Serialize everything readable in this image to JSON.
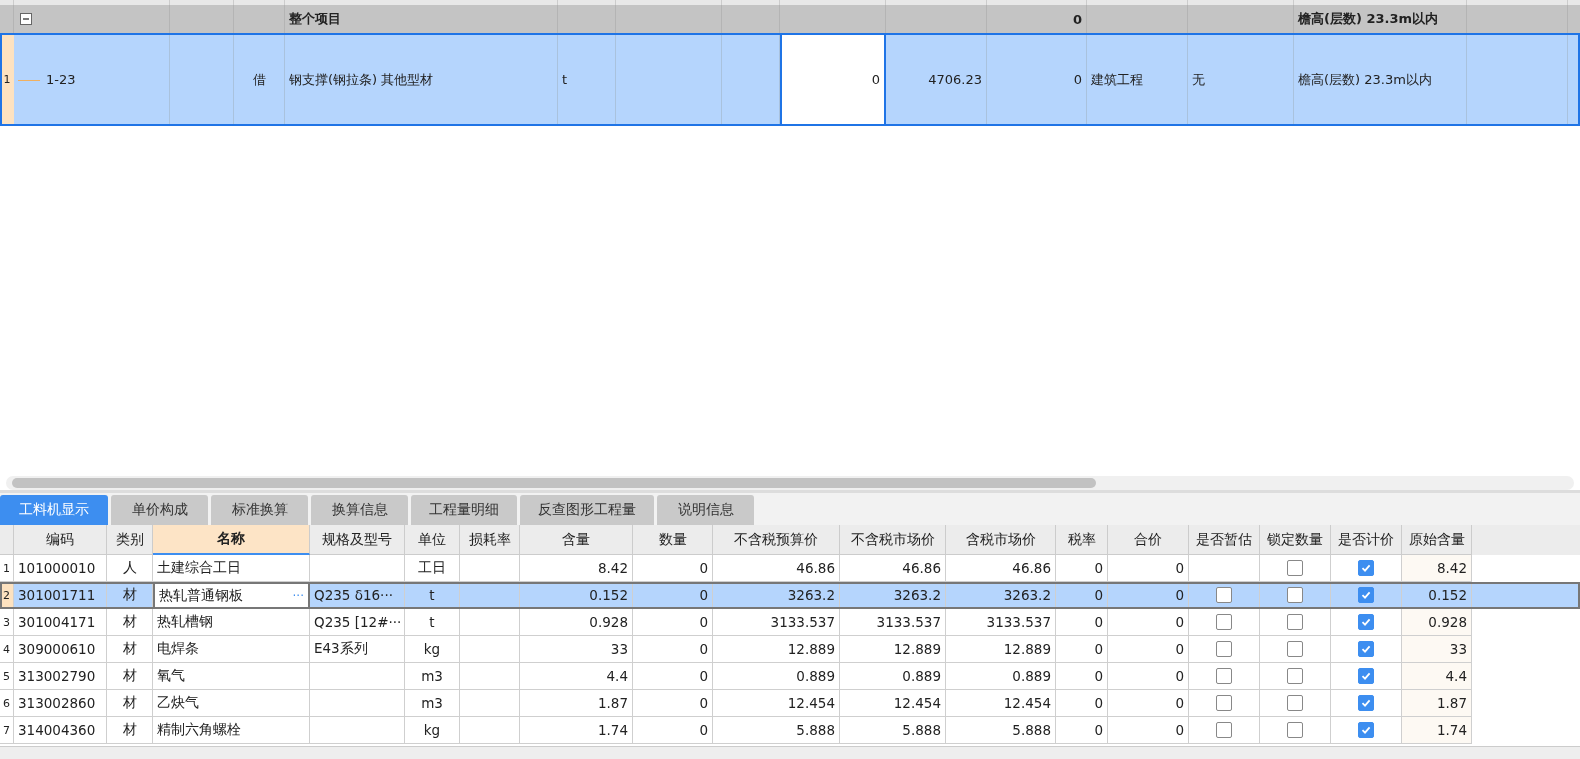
{
  "top_grid": {
    "group_row": {
      "expanded": true,
      "name": "整个项目",
      "total": "0",
      "height_class": "檐高(层数) 23.3m以内"
    },
    "rows": [
      {
        "row_number": "1",
        "selected": true,
        "code": "1-23",
        "mark": "借",
        "name": "钢支撑(钢拉条) 其他型材",
        "unit": "t",
        "quantity": "0",
        "quantity_editing": true,
        "price": "4706.23",
        "total": "0",
        "category": "建筑工程",
        "column_11": "无",
        "height_class": "檐高(层数) 23.3m以内"
      }
    ]
  },
  "tabs": [
    {
      "label": "工料机显示",
      "selected": true
    },
    {
      "label": "单价构成",
      "selected": false
    },
    {
      "label": "标准换算",
      "selected": false
    },
    {
      "label": "换算信息",
      "selected": false
    },
    {
      "label": "工程量明细",
      "selected": false
    },
    {
      "label": "反查图形工程量",
      "selected": false
    },
    {
      "label": "说明信息",
      "selected": false
    }
  ],
  "table": {
    "columns": [
      {
        "label": "编码",
        "selected": false
      },
      {
        "label": "类别",
        "selected": false
      },
      {
        "label": "名称",
        "selected": true
      },
      {
        "label": "规格及型号",
        "selected": false
      },
      {
        "label": "单位",
        "selected": false
      },
      {
        "label": "损耗率",
        "selected": false
      },
      {
        "label": "含量",
        "selected": false
      },
      {
        "label": "数量",
        "selected": false
      },
      {
        "label": "不含税预算价",
        "selected": false
      },
      {
        "label": "不含税市场价",
        "selected": false
      },
      {
        "label": "含税市场价",
        "selected": false
      },
      {
        "label": "税率",
        "selected": false
      },
      {
        "label": "合价",
        "selected": false
      },
      {
        "label": "是否暂估",
        "selected": false
      },
      {
        "label": "锁定数量",
        "selected": false
      },
      {
        "label": "是否计价",
        "selected": false
      },
      {
        "label": "原始含量",
        "selected": false
      }
    ],
    "rows": [
      {
        "row_number": "1",
        "selected": false,
        "code": "101000010",
        "type": "人",
        "name": "土建综合工日",
        "unit": "工日",
        "content": "8.42",
        "quantity": "0",
        "budget_price": "46.86",
        "market_price": "46.86",
        "tax_market_price": "46.86",
        "tax_rate": "0",
        "total": "0",
        "locked": false,
        "priced": true,
        "original_content": "8.42"
      },
      {
        "row_number": "2",
        "selected": true,
        "code": "301001711",
        "type": "材",
        "name": "热轧普通钢板",
        "name_button": "···",
        "spec": "Q235 δ16···",
        "unit": "t",
        "content": "0.152",
        "quantity": "0",
        "budget_price": "3263.2",
        "market_price": "3263.2",
        "tax_market_price": "3263.2",
        "tax_rate": "0",
        "total": "0",
        "provisional": false,
        "locked": false,
        "priced": true,
        "original_content": "0.152"
      },
      {
        "row_number": "3",
        "selected": false,
        "code": "301004171",
        "type": "材",
        "name": "热轧槽钢",
        "spec": "Q235 [12#···",
        "unit": "t",
        "content": "0.928",
        "quantity": "0",
        "budget_price": "3133.537",
        "market_price": "3133.537",
        "tax_market_price": "3133.537",
        "tax_rate": "0",
        "total": "0",
        "provisional": false,
        "locked": false,
        "priced": true,
        "original_content": "0.928"
      },
      {
        "row_number": "4",
        "selected": false,
        "code": "309000610",
        "type": "材",
        "name": "电焊条",
        "spec": "E43系列",
        "unit": "kg",
        "content": "33",
        "quantity": "0",
        "budget_price": "12.889",
        "market_price": "12.889",
        "tax_market_price": "12.889",
        "tax_rate": "0",
        "total": "0",
        "provisional": false,
        "locked": false,
        "priced": true,
        "original_content": "33"
      },
      {
        "row_number": "5",
        "selected": false,
        "code": "313002790",
        "type": "材",
        "name": "氧气",
        "unit": "m3",
        "content": "4.4",
        "quantity": "0",
        "budget_price": "0.889",
        "market_price": "0.889",
        "tax_market_price": "0.889",
        "tax_rate": "0",
        "total": "0",
        "provisional": false,
        "locked": false,
        "priced": true,
        "original_content": "4.4"
      },
      {
        "row_number": "6",
        "selected": false,
        "code": "313002860",
        "type": "材",
        "name": "乙炔气",
        "unit": "m3",
        "content": "1.87",
        "quantity": "0",
        "budget_price": "12.454",
        "market_price": "12.454",
        "tax_market_price": "12.454",
        "tax_rate": "0",
        "total": "0",
        "provisional": false,
        "locked": false,
        "priced": true,
        "original_content": "1.87"
      },
      {
        "row_number": "7",
        "selected": false,
        "code": "314004360",
        "type": "材",
        "name": "精制六角螺栓",
        "unit": "kg",
        "content": "1.74",
        "quantity": "0",
        "budget_price": "5.888",
        "market_price": "5.888",
        "tax_market_price": "5.888",
        "tax_rate": "0",
        "total": "0",
        "provisional": false,
        "locked": false,
        "priced": true,
        "original_content": "1.74"
      }
    ]
  }
}
